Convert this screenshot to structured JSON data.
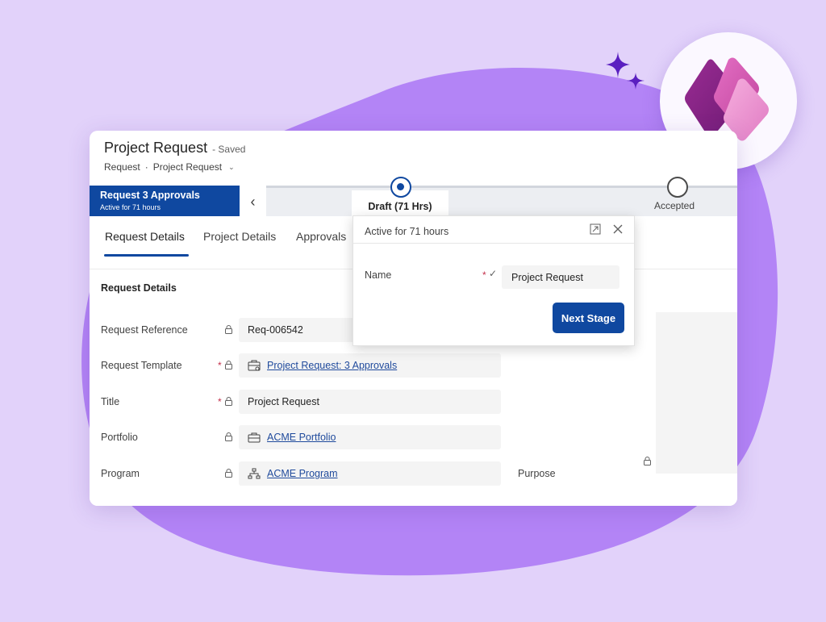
{
  "header": {
    "title": "Project Request",
    "status": "- Saved",
    "breadcrumb": {
      "entity": "Request",
      "separator": "·",
      "form": "Project Request"
    }
  },
  "bpf": {
    "active_stage": {
      "title": "Request 3 Approvals",
      "subtitle": "Active for 71 hours"
    },
    "current_stage_label": "Draft  (71 Hrs)",
    "next_stage_label": "Accepted"
  },
  "tabs": [
    {
      "label": "Request Details",
      "active": true
    },
    {
      "label": "Project Details",
      "active": false
    },
    {
      "label": "Approvals",
      "active": false
    }
  ],
  "section": {
    "title": "Request Details"
  },
  "fields": [
    {
      "label": "Request Reference",
      "value": "Req-006542",
      "required": false,
      "icon": "lock-icon"
    },
    {
      "label": "Request Template",
      "value": "Project Request: 3 Approvals",
      "required": true,
      "link": true,
      "icon": "template-icon"
    },
    {
      "label": "Title",
      "value": "Project Request",
      "required": true
    },
    {
      "label": "Portfolio",
      "value": "ACME Portfolio",
      "required": false,
      "link": true,
      "icon": "briefcase-icon"
    },
    {
      "label": "Program",
      "value": "ACME Program",
      "required": false,
      "link": true,
      "icon": "hierarchy-icon"
    }
  ],
  "right_column": {
    "purpose_label": "Purpose"
  },
  "flyout": {
    "title": "Active for 71 hours",
    "name_label": "Name",
    "name_value": "Project Request",
    "check_glyph": "✓",
    "next_button": "Next Stage"
  },
  "colors": {
    "background": "#e2d2fa",
    "blob": "#b384f6",
    "accent": "#0f48a0",
    "link": "#1f4a9c",
    "required": "#c4314b",
    "sparkle": "#5a1fc0"
  }
}
